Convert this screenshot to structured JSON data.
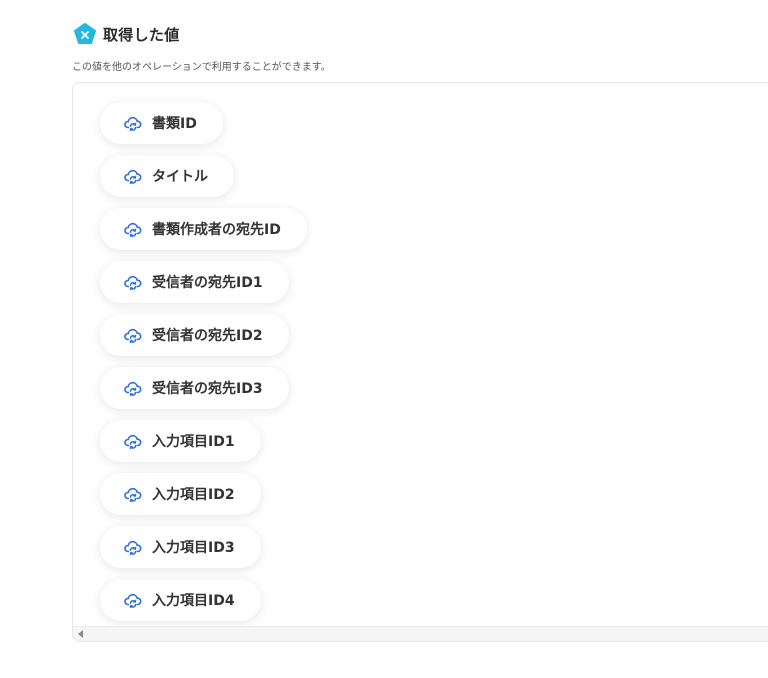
{
  "section": {
    "title": "取得した値",
    "description": "この値を他のオペレーションで利用することができます。",
    "badge_icon": "x-badge-icon",
    "badge_color": "#22b8e0"
  },
  "outputs": {
    "item_icon": "cloud-refresh-icon",
    "icon_color": "#2f6fd6",
    "items": [
      {
        "label": "書類ID"
      },
      {
        "label": "タイトル"
      },
      {
        "label": "書類作成者の宛先ID"
      },
      {
        "label": "受信者の宛先ID1"
      },
      {
        "label": "受信者の宛先ID2"
      },
      {
        "label": "受信者の宛先ID3"
      },
      {
        "label": "入力項目ID1"
      },
      {
        "label": "入力項目ID2"
      },
      {
        "label": "入力項目ID3"
      },
      {
        "label": "入力項目ID4"
      }
    ]
  }
}
